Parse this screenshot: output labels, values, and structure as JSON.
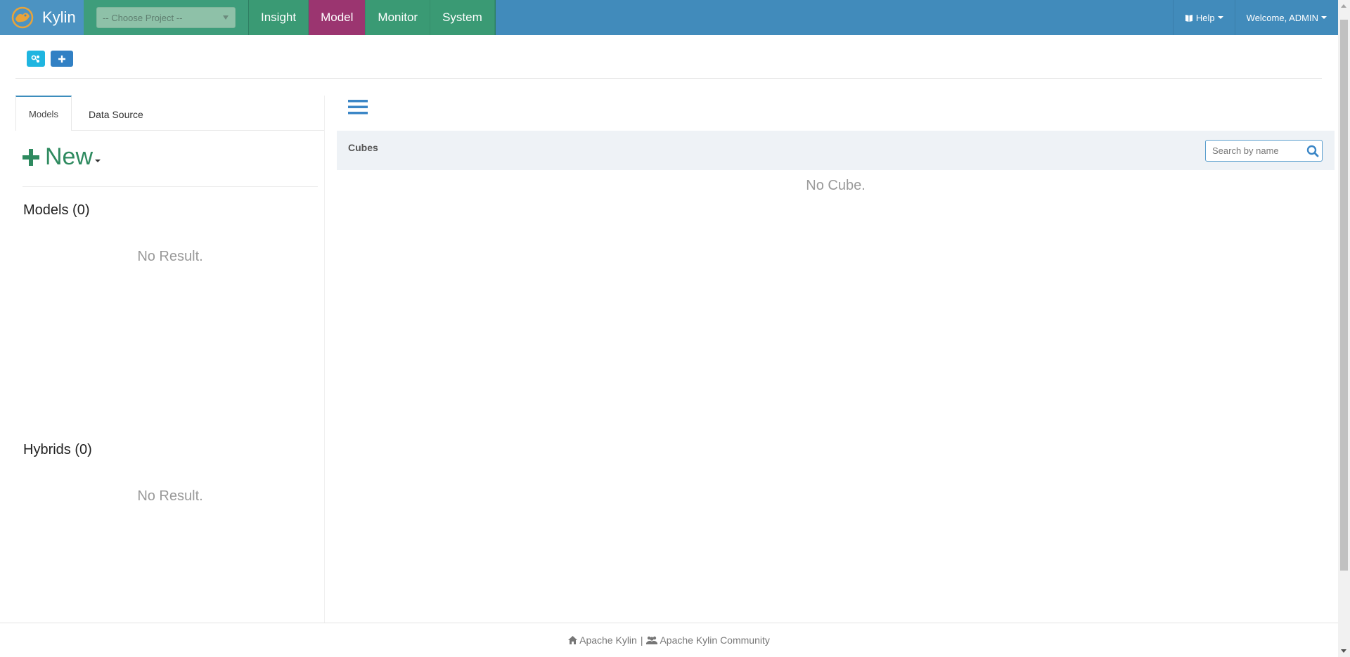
{
  "navbar": {
    "brand": "Kylin",
    "project_select": "-- Choose Project --",
    "tabs": [
      {
        "label": "Insight",
        "active": false
      },
      {
        "label": "Model",
        "active": true
      },
      {
        "label": "Monitor",
        "active": false
      },
      {
        "label": "System",
        "active": false
      }
    ],
    "help_label": "Help",
    "welcome_label": "Welcome, ADMIN"
  },
  "left_panel": {
    "tabs": [
      "Models",
      "Data Source"
    ],
    "new_label": "New",
    "models_title": "Models (0)",
    "models_empty": "No Result.",
    "hybrids_title": "Hybrids (0)",
    "hybrids_empty": "No Result."
  },
  "right_panel": {
    "cubes_title": "Cubes",
    "search_placeholder": "Search by name",
    "empty_text": "No Cube."
  },
  "footer": {
    "link1": "Apache Kylin",
    "separator": "|",
    "link2": "Apache Kylin Community"
  },
  "colors": {
    "navbar": "#418bbb",
    "nav_tab": "#3a9a74",
    "nav_tab_active": "#9b3570",
    "new_button": "#2e8a5f"
  }
}
